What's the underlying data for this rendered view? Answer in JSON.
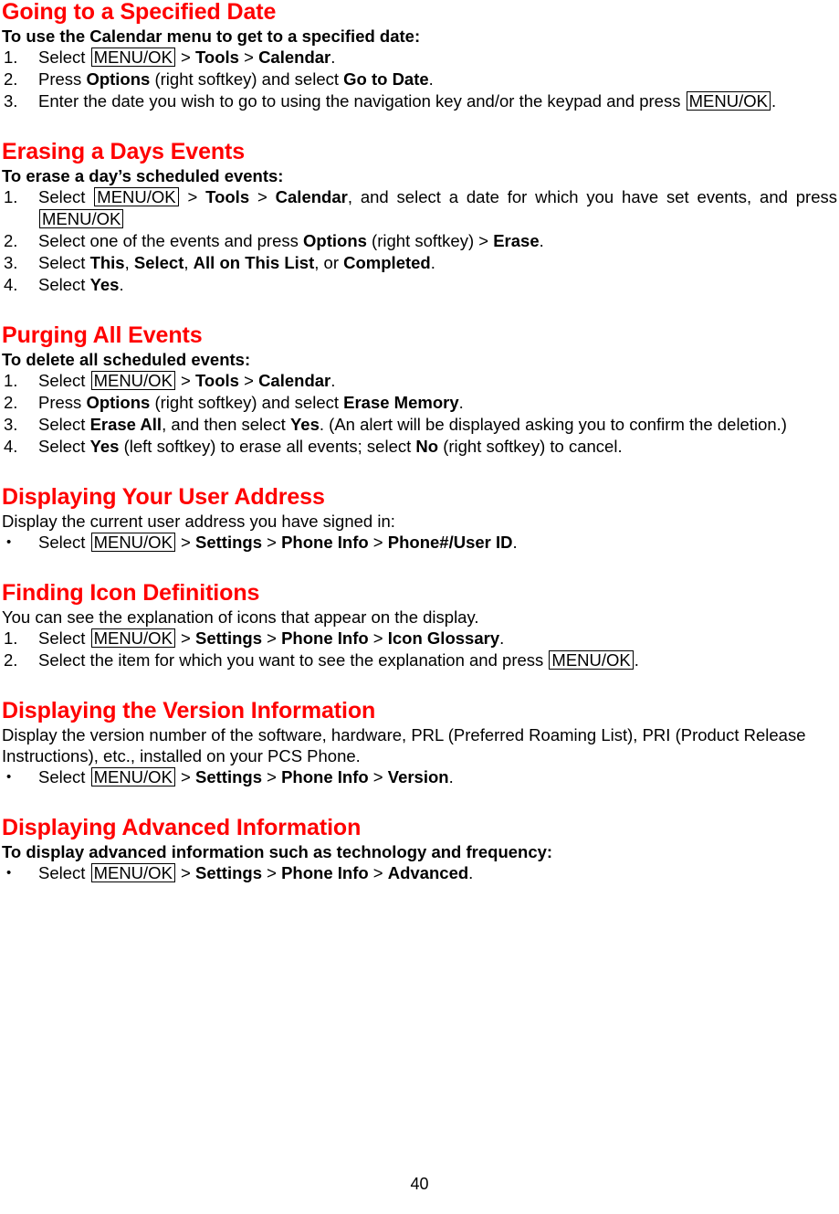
{
  "document": {
    "page_number": "40",
    "heading_color": "#FF0000",
    "body_color": "#000000"
  },
  "sections": [
    {
      "title": "Going to a Specified Date",
      "subhead": "To use the Calendar menu to get to a specified date:",
      "list_type": "ordered",
      "items": [
        {
          "marker": "1.",
          "parts": [
            {
              "t": "text",
              "v": "Select "
            },
            {
              "t": "key",
              "v": "MENU/OK"
            },
            {
              "t": "text",
              "v": " > "
            },
            {
              "t": "bold",
              "v": "Tools"
            },
            {
              "t": "text",
              "v": " > "
            },
            {
              "t": "bold",
              "v": "Calendar"
            },
            {
              "t": "text",
              "v": "."
            }
          ]
        },
        {
          "marker": "2.",
          "parts": [
            {
              "t": "text",
              "v": "Press "
            },
            {
              "t": "bold",
              "v": "Options"
            },
            {
              "t": "text",
              "v": " (right softkey) and select "
            },
            {
              "t": "bold",
              "v": "Go to Date"
            },
            {
              "t": "text",
              "v": "."
            }
          ]
        },
        {
          "marker": "3.",
          "parts": [
            {
              "t": "text",
              "v": "Enter the date you wish to go to using the navigation key and/or the keypad and press "
            },
            {
              "t": "key",
              "v": "MENU/OK"
            },
            {
              "t": "text",
              "v": "."
            }
          ]
        }
      ]
    },
    {
      "title": "Erasing a Days Events",
      "subhead": "To erase a day’s scheduled events:",
      "list_type": "ordered",
      "items": [
        {
          "marker": "1.",
          "justify": true,
          "parts": [
            {
              "t": "text",
              "v": "Select "
            },
            {
              "t": "key",
              "v": "MENU/OK"
            },
            {
              "t": "text",
              "v": " > "
            },
            {
              "t": "bold",
              "v": "Tools"
            },
            {
              "t": "text",
              "v": " > "
            },
            {
              "t": "bold",
              "v": "Calendar"
            },
            {
              "t": "text",
              "v": ", and select a date for which you have set events, and press "
            },
            {
              "t": "key",
              "v": "MENU/OK"
            }
          ]
        },
        {
          "marker": "2.",
          "parts": [
            {
              "t": "text",
              "v": "Select one of the events and press "
            },
            {
              "t": "bold",
              "v": "Options"
            },
            {
              "t": "text",
              "v": " (right softkey) > "
            },
            {
              "t": "bold",
              "v": "Erase"
            },
            {
              "t": "text",
              "v": "."
            }
          ]
        },
        {
          "marker": "3.",
          "parts": [
            {
              "t": "text",
              "v": "Select "
            },
            {
              "t": "bold",
              "v": "This"
            },
            {
              "t": "text",
              "v": ", "
            },
            {
              "t": "bold",
              "v": "Select"
            },
            {
              "t": "text",
              "v": ", "
            },
            {
              "t": "bold",
              "v": "All on This List"
            },
            {
              "t": "text",
              "v": ", or "
            },
            {
              "t": "bold",
              "v": "Completed"
            },
            {
              "t": "text",
              "v": "."
            }
          ]
        },
        {
          "marker": "4.",
          "parts": [
            {
              "t": "text",
              "v": "Select "
            },
            {
              "t": "bold",
              "v": "Yes"
            },
            {
              "t": "text",
              "v": "."
            }
          ]
        }
      ]
    },
    {
      "title": "Purging All Events",
      "subhead": "To delete all scheduled events:",
      "list_type": "ordered",
      "items": [
        {
          "marker": "1.",
          "parts": [
            {
              "t": "text",
              "v": "Select "
            },
            {
              "t": "key",
              "v": "MENU/OK"
            },
            {
              "t": "text",
              "v": " > "
            },
            {
              "t": "bold",
              "v": "Tools"
            },
            {
              "t": "text",
              "v": " > "
            },
            {
              "t": "bold",
              "v": "Calendar"
            },
            {
              "t": "text",
              "v": "."
            }
          ]
        },
        {
          "marker": "2.",
          "parts": [
            {
              "t": "text",
              "v": "Press "
            },
            {
              "t": "bold",
              "v": "Options"
            },
            {
              "t": "text",
              "v": " (right softkey) and select "
            },
            {
              "t": "bold",
              "v": "Erase Memory"
            },
            {
              "t": "text",
              "v": "."
            }
          ]
        },
        {
          "marker": "3.",
          "parts": [
            {
              "t": "text",
              "v": "Select "
            },
            {
              "t": "bold",
              "v": "Erase All"
            },
            {
              "t": "text",
              "v": ", and then select "
            },
            {
              "t": "bold",
              "v": "Yes"
            },
            {
              "t": "text",
              "v": ". (An alert will be displayed asking you to confirm the deletion.)"
            }
          ]
        },
        {
          "marker": "4.",
          "parts": [
            {
              "t": "text",
              "v": "Select "
            },
            {
              "t": "bold",
              "v": "Yes"
            },
            {
              "t": "text",
              "v": " (left softkey) to erase all events; select "
            },
            {
              "t": "bold",
              "v": "No"
            },
            {
              "t": "text",
              "v": " (right softkey) to cancel."
            }
          ]
        }
      ]
    },
    {
      "title": "Displaying Your User Address",
      "intro": "Display the current user address you have signed in:",
      "list_type": "bulleted",
      "items": [
        {
          "marker": "•",
          "parts": [
            {
              "t": "text",
              "v": "Select "
            },
            {
              "t": "key",
              "v": "MENU/OK"
            },
            {
              "t": "text",
              "v": " > "
            },
            {
              "t": "bold",
              "v": "Settings"
            },
            {
              "t": "text",
              "v": " > "
            },
            {
              "t": "bold",
              "v": "Phone Info"
            },
            {
              "t": "text",
              "v": " > "
            },
            {
              "t": "bold",
              "v": "Phone#/User ID"
            },
            {
              "t": "text",
              "v": "."
            }
          ]
        }
      ]
    },
    {
      "title": "Finding Icon Definitions",
      "intro": "You can see the explanation of icons that appear on the display.",
      "list_type": "ordered",
      "items": [
        {
          "marker": "1.",
          "parts": [
            {
              "t": "text",
              "v": "Select "
            },
            {
              "t": "key",
              "v": "MENU/OK"
            },
            {
              "t": "text",
              "v": " > "
            },
            {
              "t": "bold",
              "v": "Settings"
            },
            {
              "t": "text",
              "v": " > "
            },
            {
              "t": "bold",
              "v": "Phone Info"
            },
            {
              "t": "text",
              "v": " > "
            },
            {
              "t": "bold",
              "v": "Icon Glossary"
            },
            {
              "t": "text",
              "v": "."
            }
          ]
        },
        {
          "marker": "2.",
          "parts": [
            {
              "t": "text",
              "v": "Select the item for which you want to see the explanation and press "
            },
            {
              "t": "key",
              "v": "MENU/OK"
            },
            {
              "t": "text",
              "v": "."
            }
          ]
        }
      ]
    },
    {
      "title": "Displaying the Version Information",
      "intro": "Display the version number of the software, hardware, PRL (Preferred Roaming List), PRI (Product Release Instructions), etc., installed on your PCS Phone.",
      "list_type": "bulleted",
      "items": [
        {
          "marker": "•",
          "parts": [
            {
              "t": "text",
              "v": "Select "
            },
            {
              "t": "key",
              "v": "MENU/OK"
            },
            {
              "t": "text",
              "v": " > "
            },
            {
              "t": "bold",
              "v": "Settings"
            },
            {
              "t": "text",
              "v": " > "
            },
            {
              "t": "bold",
              "v": "Phone Info"
            },
            {
              "t": "text",
              "v": " > "
            },
            {
              "t": "bold",
              "v": "Version"
            },
            {
              "t": "text",
              "v": "."
            }
          ]
        }
      ]
    },
    {
      "title": "Displaying Advanced Information",
      "subhead": "To display advanced information such as technology and frequency:",
      "list_type": "bulleted",
      "items": [
        {
          "marker": "•",
          "parts": [
            {
              "t": "text",
              "v": "Select "
            },
            {
              "t": "key",
              "v": "MENU/OK"
            },
            {
              "t": "text",
              "v": " > "
            },
            {
              "t": "bold",
              "v": "Settings"
            },
            {
              "t": "text",
              "v": " > "
            },
            {
              "t": "bold",
              "v": "Phone Info"
            },
            {
              "t": "text",
              "v": " > "
            },
            {
              "t": "bold",
              "v": "Advanced"
            },
            {
              "t": "text",
              "v": "."
            }
          ]
        }
      ]
    }
  ]
}
